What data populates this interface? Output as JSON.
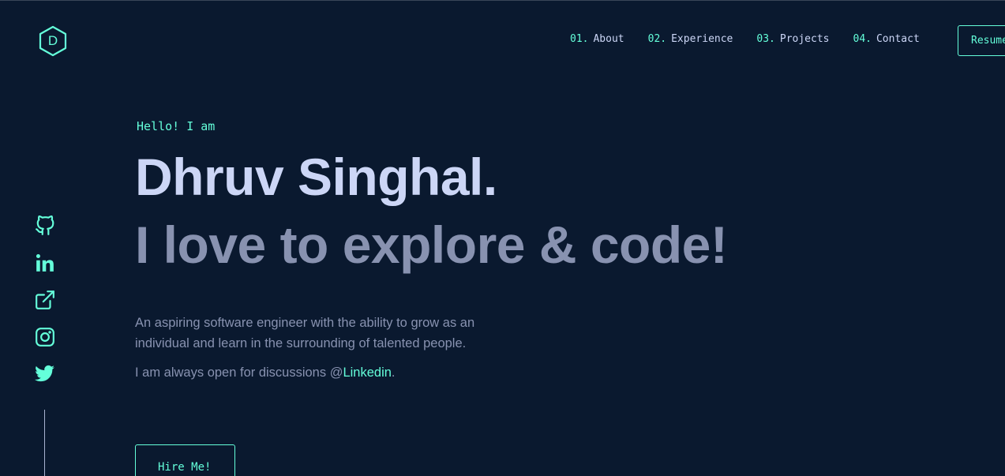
{
  "logo": {
    "letter": "D"
  },
  "nav": {
    "items": [
      {
        "num": "01.",
        "label": "About"
      },
      {
        "num": "02.",
        "label": "Experience"
      },
      {
        "num": "03.",
        "label": "Projects"
      },
      {
        "num": "04.",
        "label": "Contact"
      }
    ],
    "resume_label": "Resume"
  },
  "social": {
    "icons": [
      "github-icon",
      "linkedin-icon",
      "external-link-icon",
      "instagram-icon",
      "twitter-icon"
    ]
  },
  "hero": {
    "greeting": "Hello! I am",
    "name": "Dhruv Singhal.",
    "tagline": "I love to explore & code!",
    "description": "An aspiring software engineer with the ability to grow as an individual and learn in the surrounding of talented people.",
    "discussion_prefix": "I am always open for discussions @",
    "discussion_link": "Linkedin",
    "discussion_suffix": ".",
    "hire_label": "Hire Me!"
  },
  "colors": {
    "background": "#0a192f",
    "accent": "#64ffda",
    "heading": "#ccd6f6",
    "muted": "#8892b0"
  }
}
